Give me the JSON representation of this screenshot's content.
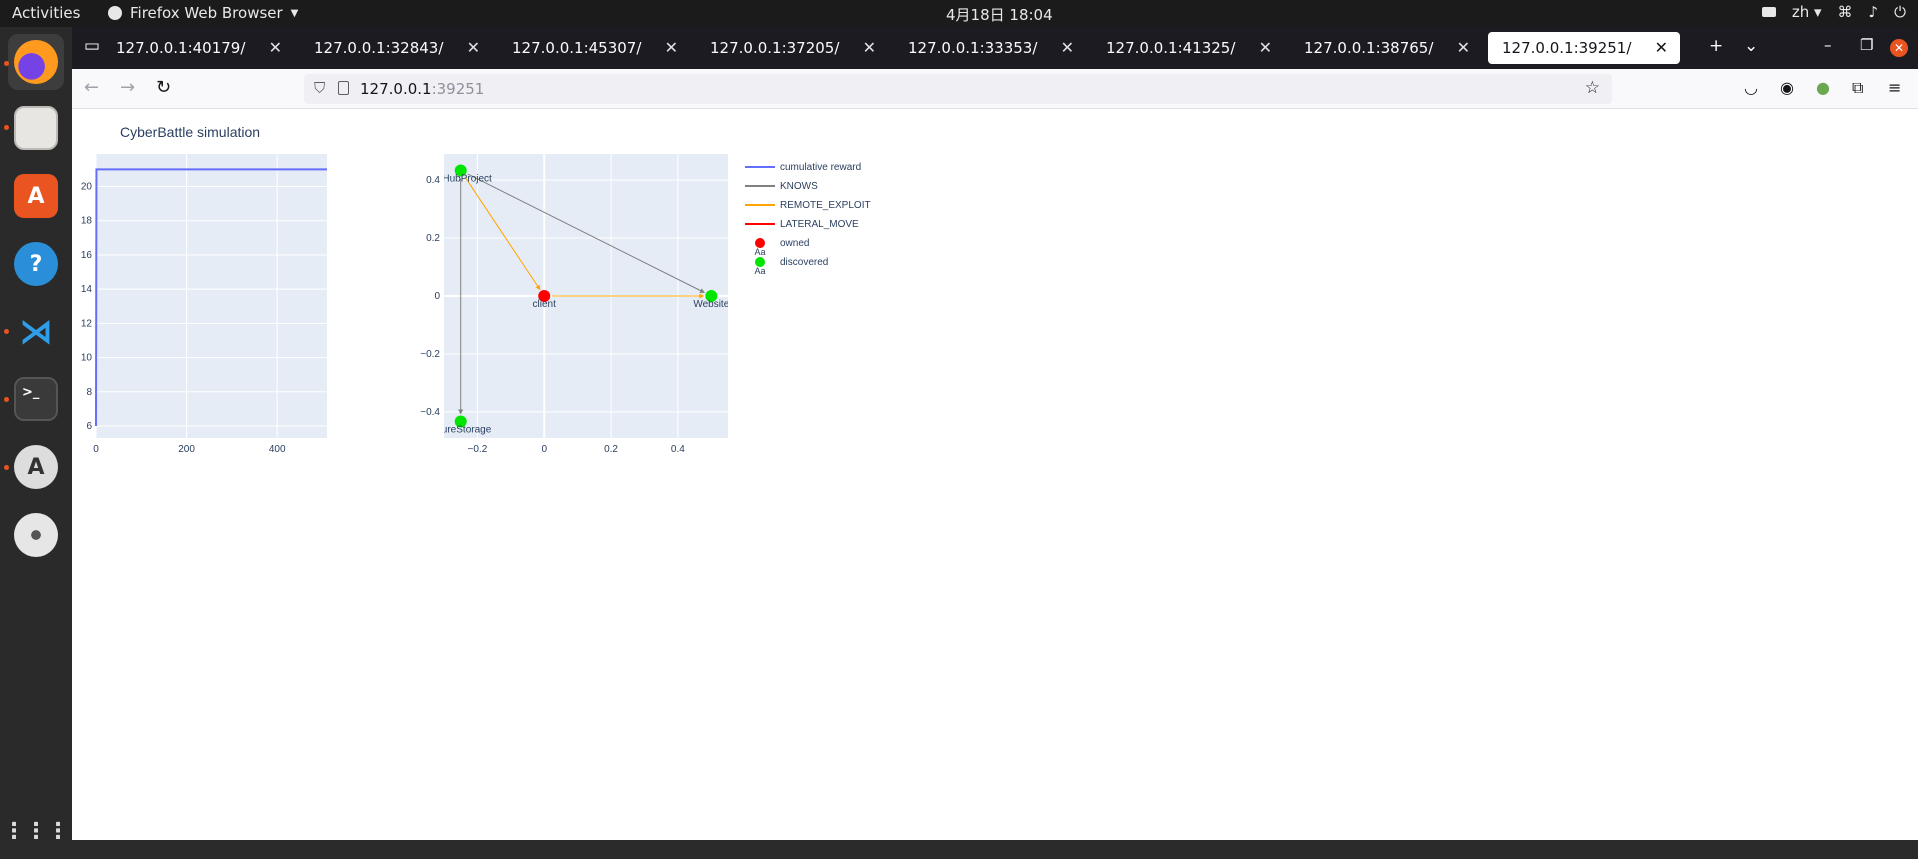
{
  "topbar": {
    "activities": "Activities",
    "app_name": "Firefox Web Browser",
    "clock": "4月18日  18:04",
    "lang": "zh"
  },
  "tabs": [
    {
      "label": "127.0.0.1:40179/"
    },
    {
      "label": "127.0.0.1:32843/"
    },
    {
      "label": "127.0.0.1:45307/"
    },
    {
      "label": "127.0.0.1:37205/"
    },
    {
      "label": "127.0.0.1:33353/"
    },
    {
      "label": "127.0.0.1:41325/"
    },
    {
      "label": "127.0.0.1:38765/"
    },
    {
      "label": "127.0.0.1:39251/"
    }
  ],
  "active_tab": 7,
  "url": {
    "host": "127.0.0.1",
    "port": ":39251"
  },
  "page": {
    "title": "CyberBattle simulation"
  },
  "colors": {
    "plot_bg": "#e5ecf6",
    "reward_line": "#636efa",
    "knows": "#808080",
    "remote_exploit": "#ffa500",
    "lateral_move": "#ff0000",
    "owned": "#ff0000",
    "discovered": "#00e600"
  },
  "chart_data": [
    {
      "type": "line",
      "xlim": [
        0,
        510
      ],
      "ylim": [
        5.3,
        21.9
      ],
      "xticks": [
        0,
        200,
        400
      ],
      "yticks": [
        6,
        8,
        10,
        12,
        14,
        16,
        18,
        20
      ],
      "series": [
        {
          "name": "cumulative reward",
          "x": [
            0,
            1,
            510
          ],
          "y": [
            6,
            21,
            21
          ]
        }
      ],
      "grid": true
    },
    {
      "type": "scatter",
      "xlim": [
        -0.3,
        0.55
      ],
      "ylim": [
        -0.49,
        0.49
      ],
      "xticks": [
        -0.2,
        0,
        0.2,
        0.4
      ],
      "yticks": [
        0.4,
        0.2,
        0,
        -0.2,
        -0.4
      ],
      "nodes": [
        {
          "label": "client",
          "x": 0.0,
          "y": 0.0,
          "status": "owned"
        },
        {
          "label": "Website",
          "x": 0.5,
          "y": 0.0,
          "status": "discovered"
        },
        {
          "label": "GitHubProject",
          "x": -0.25,
          "y": 0.433,
          "status": "discovered"
        },
        {
          "label": "AzureStorage",
          "x": -0.25,
          "y": -0.433,
          "status": "discovered"
        }
      ],
      "edges": [
        {
          "from": "GitHubProject",
          "to": "Website",
          "kind": "KNOWS"
        },
        {
          "from": "GitHubProject",
          "to": "AzureStorage",
          "kind": "KNOWS"
        },
        {
          "from": "client",
          "to": "Website",
          "kind": "REMOTE_EXPLOIT"
        },
        {
          "from": "GitHubProject",
          "to": "client",
          "kind": "REMOTE_EXPLOIT"
        }
      ],
      "legend": [
        {
          "label": "cumulative reward",
          "kind": "line",
          "color": "#636efa"
        },
        {
          "label": "KNOWS",
          "kind": "line",
          "color": "#808080"
        },
        {
          "label": "REMOTE_EXPLOIT",
          "kind": "line",
          "color": "#ffa500"
        },
        {
          "label": "LATERAL_MOVE",
          "kind": "line",
          "color": "#ff0000"
        },
        {
          "label": "owned",
          "kind": "marker",
          "color": "#ff0000"
        },
        {
          "label": "discovered",
          "kind": "marker",
          "color": "#00e600"
        }
      ],
      "legend_marker_text": "Aa",
      "legend_position": "right",
      "grid": true
    }
  ]
}
